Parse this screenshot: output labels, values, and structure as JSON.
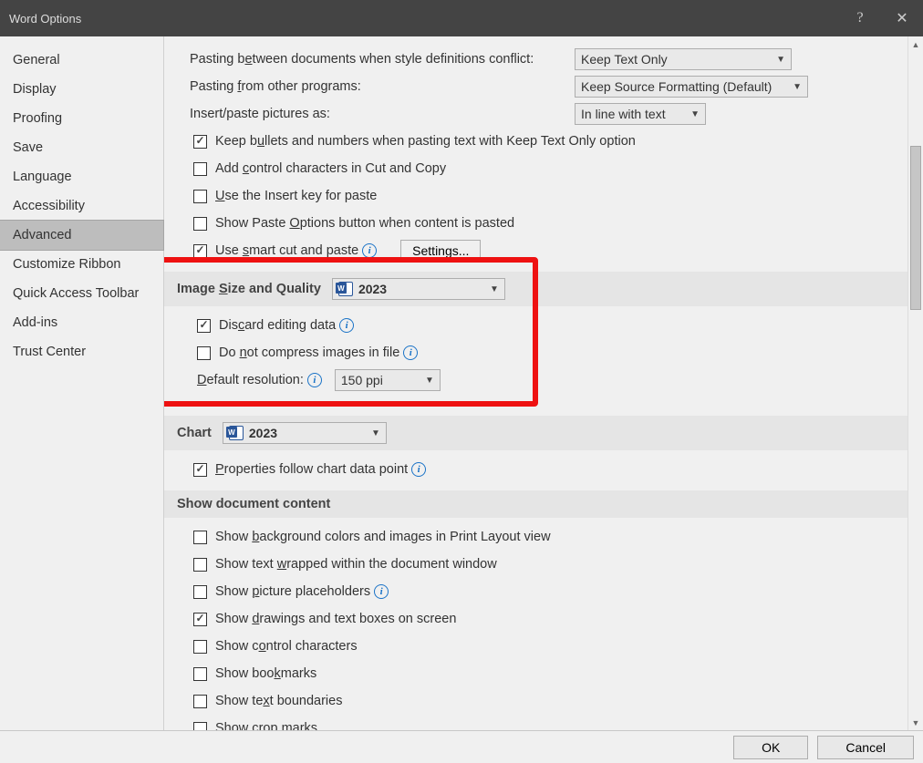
{
  "titlebar": {
    "title": "Word Options"
  },
  "sidebar": {
    "items": [
      "General",
      "Display",
      "Proofing",
      "Save",
      "Language",
      "Accessibility",
      "Advanced",
      "Customize Ribbon",
      "Quick Access Toolbar",
      "Add-ins",
      "Trust Center"
    ],
    "active_index": 6
  },
  "paste": {
    "between_docs_label_pre": "Pasting b",
    "between_docs_label_mid": "e",
    "between_docs_label_post": "tween documents when style definitions conflict:",
    "between_docs_value": "Keep Text Only",
    "other_programs_label_pre": "Pasting ",
    "other_programs_label_u": "f",
    "other_programs_label_post": "rom other programs:",
    "other_programs_value": "Keep Source Formatting (Default)",
    "insert_pictures_label": "Insert/paste pictures as:",
    "insert_pictures_value": "In line with text",
    "keep_bullets": {
      "checked": true,
      "pre": "Keep b",
      "u": "u",
      "post": "llets and numbers when pasting text with Keep Text Only option"
    },
    "control_chars": {
      "checked": false,
      "pre": "Add ",
      "u": "c",
      "post": "ontrol characters in Cut and Copy"
    },
    "insert_key": {
      "checked": false,
      "pre": "",
      "u": "U",
      "post": "se the Insert key for paste"
    },
    "paste_options": {
      "checked": false,
      "pre": "Show Paste ",
      "u": "O",
      "post": "ptions button when content is pasted"
    },
    "smart_cut": {
      "checked": true,
      "pre": "Use ",
      "u": "s",
      "post": "mart cut and paste"
    },
    "settings_button": "Settings..."
  },
  "image_quality": {
    "header_pre": "Image ",
    "header_u": "S",
    "header_post": "ize and Quality",
    "doc_value": "2023",
    "discard": {
      "checked": true,
      "pre": "Dis",
      "u": "c",
      "post": "ard editing data"
    },
    "nocompress": {
      "checked": false,
      "pre": "Do ",
      "u": "n",
      "post": "ot compress images in file"
    },
    "resolution_label_pre": "",
    "resolution_label_u": "D",
    "resolution_label_post": "efault resolution:",
    "resolution_value": "150 ppi"
  },
  "chart": {
    "header": "Chart",
    "doc_value": "2023",
    "props": {
      "checked": true,
      "pre": "",
      "u": "P",
      "post": "roperties follow chart data point"
    }
  },
  "docContent": {
    "header": "Show document content",
    "bg": {
      "checked": false,
      "pre": "Show ",
      "u": "b",
      "post": "ackground colors and images in Print Layout view"
    },
    "wrap": {
      "checked": false,
      "pre": "Show text ",
      "u": "w",
      "post": "rapped within the document window"
    },
    "placeholders": {
      "checked": false,
      "pre": "Show ",
      "u": "p",
      "post": "icture placeholders"
    },
    "drawings": {
      "checked": true,
      "pre": "Show ",
      "u": "d",
      "post": "rawings and text boxes on screen"
    },
    "ctrlchars": {
      "checked": false,
      "pre": "Show c",
      "u": "o",
      "post": "ntrol characters"
    },
    "bookmarks": {
      "checked": false,
      "pre": "Show boo",
      "u": "k",
      "post": "marks"
    },
    "boundaries": {
      "checked": false,
      "pre": "Show te",
      "u": "x",
      "post": "t boundaries"
    },
    "crop": {
      "checked": false,
      "pre": "Show c",
      "u": "r",
      "post": "op marks"
    }
  },
  "footer": {
    "ok": "OK",
    "cancel": "Cancel"
  }
}
